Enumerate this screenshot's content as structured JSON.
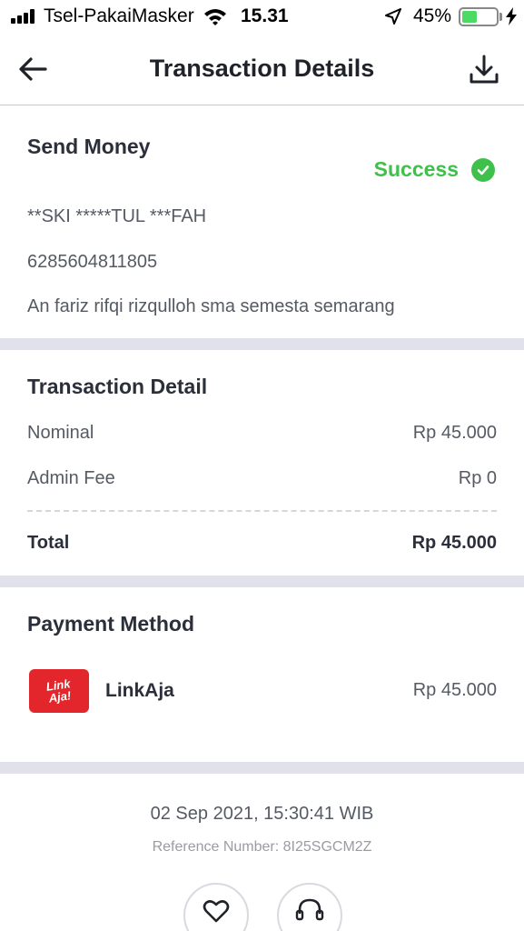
{
  "status_bar": {
    "carrier": "Tsel-PakaiMasker",
    "time": "15.31",
    "battery_percent": "45%",
    "battery_level": 0.45
  },
  "header": {
    "title": "Transaction Details",
    "back_icon": "arrow-left-icon",
    "download_icon": "download-icon"
  },
  "summary": {
    "title": "Send Money",
    "status": "Success",
    "status_color": "#3fc04b",
    "recipient_name": "**SKI *****TUL ***FAH",
    "phone": "6285604811805",
    "note": "An fariz rifqi rizqulloh sma semesta semarang"
  },
  "transaction_detail": {
    "title": "Transaction Detail",
    "rows": [
      {
        "label": "Nominal",
        "value": "Rp 45.000"
      },
      {
        "label": "Admin Fee",
        "value": "Rp 0"
      }
    ],
    "total_label": "Total",
    "total_value": "Rp 45.000"
  },
  "payment_method": {
    "title": "Payment Method",
    "logo_text": "Link Aja!",
    "logo_color": "#e3262b",
    "name": "LinkAja",
    "amount": "Rp 45.000"
  },
  "footer": {
    "datetime": "02 Sep 2021, 15:30:41 WIB",
    "reference": "Reference Number: 8I25SGCM2Z",
    "buttons": [
      "heart-icon",
      "headset-icon"
    ]
  }
}
